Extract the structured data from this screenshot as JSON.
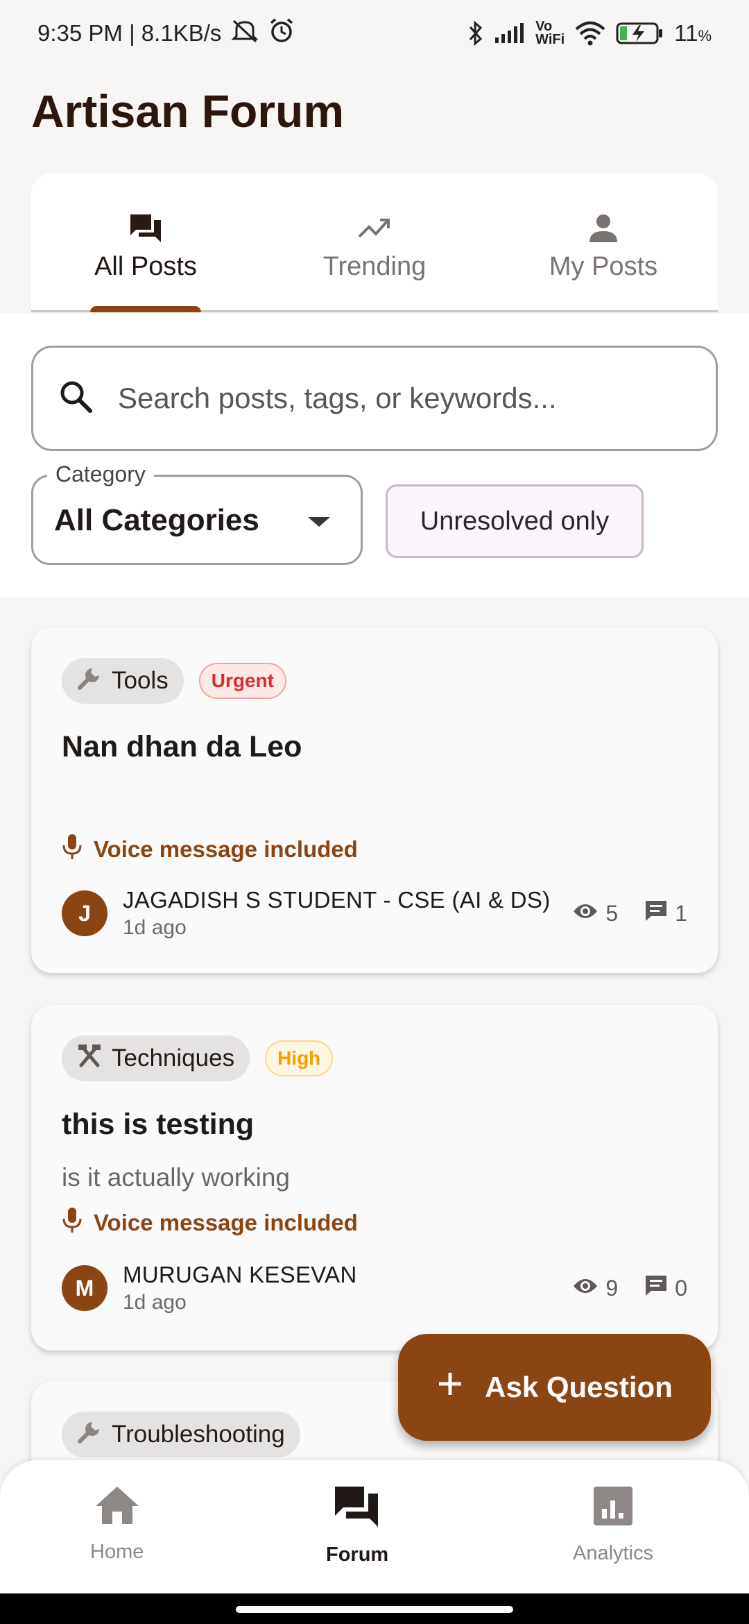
{
  "status_bar": {
    "time_speed": "9:35 PM | 8.1KB/s",
    "battery": "11",
    "battery_unit": "%",
    "vowifi_top": "Vo",
    "vowifi_bottom": "WiFi"
  },
  "app": {
    "title": "Artisan Forum"
  },
  "tabs": [
    {
      "label": "All Posts",
      "icon": "forum-icon",
      "active": true
    },
    {
      "label": "Trending",
      "icon": "trending-up-icon",
      "active": false
    },
    {
      "label": "My Posts",
      "icon": "person-icon",
      "active": false
    }
  ],
  "search": {
    "placeholder": "Search posts, tags, or keywords...",
    "value": ""
  },
  "category_filter": {
    "label": "Category",
    "value": "All Categories"
  },
  "unresolved_chip": {
    "label": "Unresolved only"
  },
  "posts": [
    {
      "category": "Tools",
      "category_icon": "wrench-icon",
      "priority": "Urgent",
      "title": "Nan dhan da Leo",
      "body": "",
      "voice_note": "Voice message included",
      "author_initial": "J",
      "author": "JAGADISH S STUDENT - CSE (AI & DS)",
      "time": "1d ago",
      "views": "5",
      "comments": "1"
    },
    {
      "category": "Techniques",
      "category_icon": "hammer-pick-icon",
      "priority": "High",
      "title": "this is testing",
      "body": "is it actually working",
      "voice_note": "Voice message included",
      "author_initial": "M",
      "author": "MURUGAN KESEVAN",
      "time": "1d ago",
      "views": "9",
      "comments": "0"
    },
    {
      "category": "Troubleshooting",
      "category_icon": "wrench-icon"
    }
  ],
  "fab": {
    "label": "Ask Question"
  },
  "bottom_nav": [
    {
      "label": "Home",
      "icon": "home-icon",
      "active": false
    },
    {
      "label": "Forum",
      "icon": "forum-icon",
      "active": true
    },
    {
      "label": "Analytics",
      "icon": "analytics-icon",
      "active": false
    }
  ],
  "colors": {
    "brand": "#8b4513",
    "title": "#2c160d",
    "urgent": "#d32f2f",
    "high": "#f0a000"
  }
}
